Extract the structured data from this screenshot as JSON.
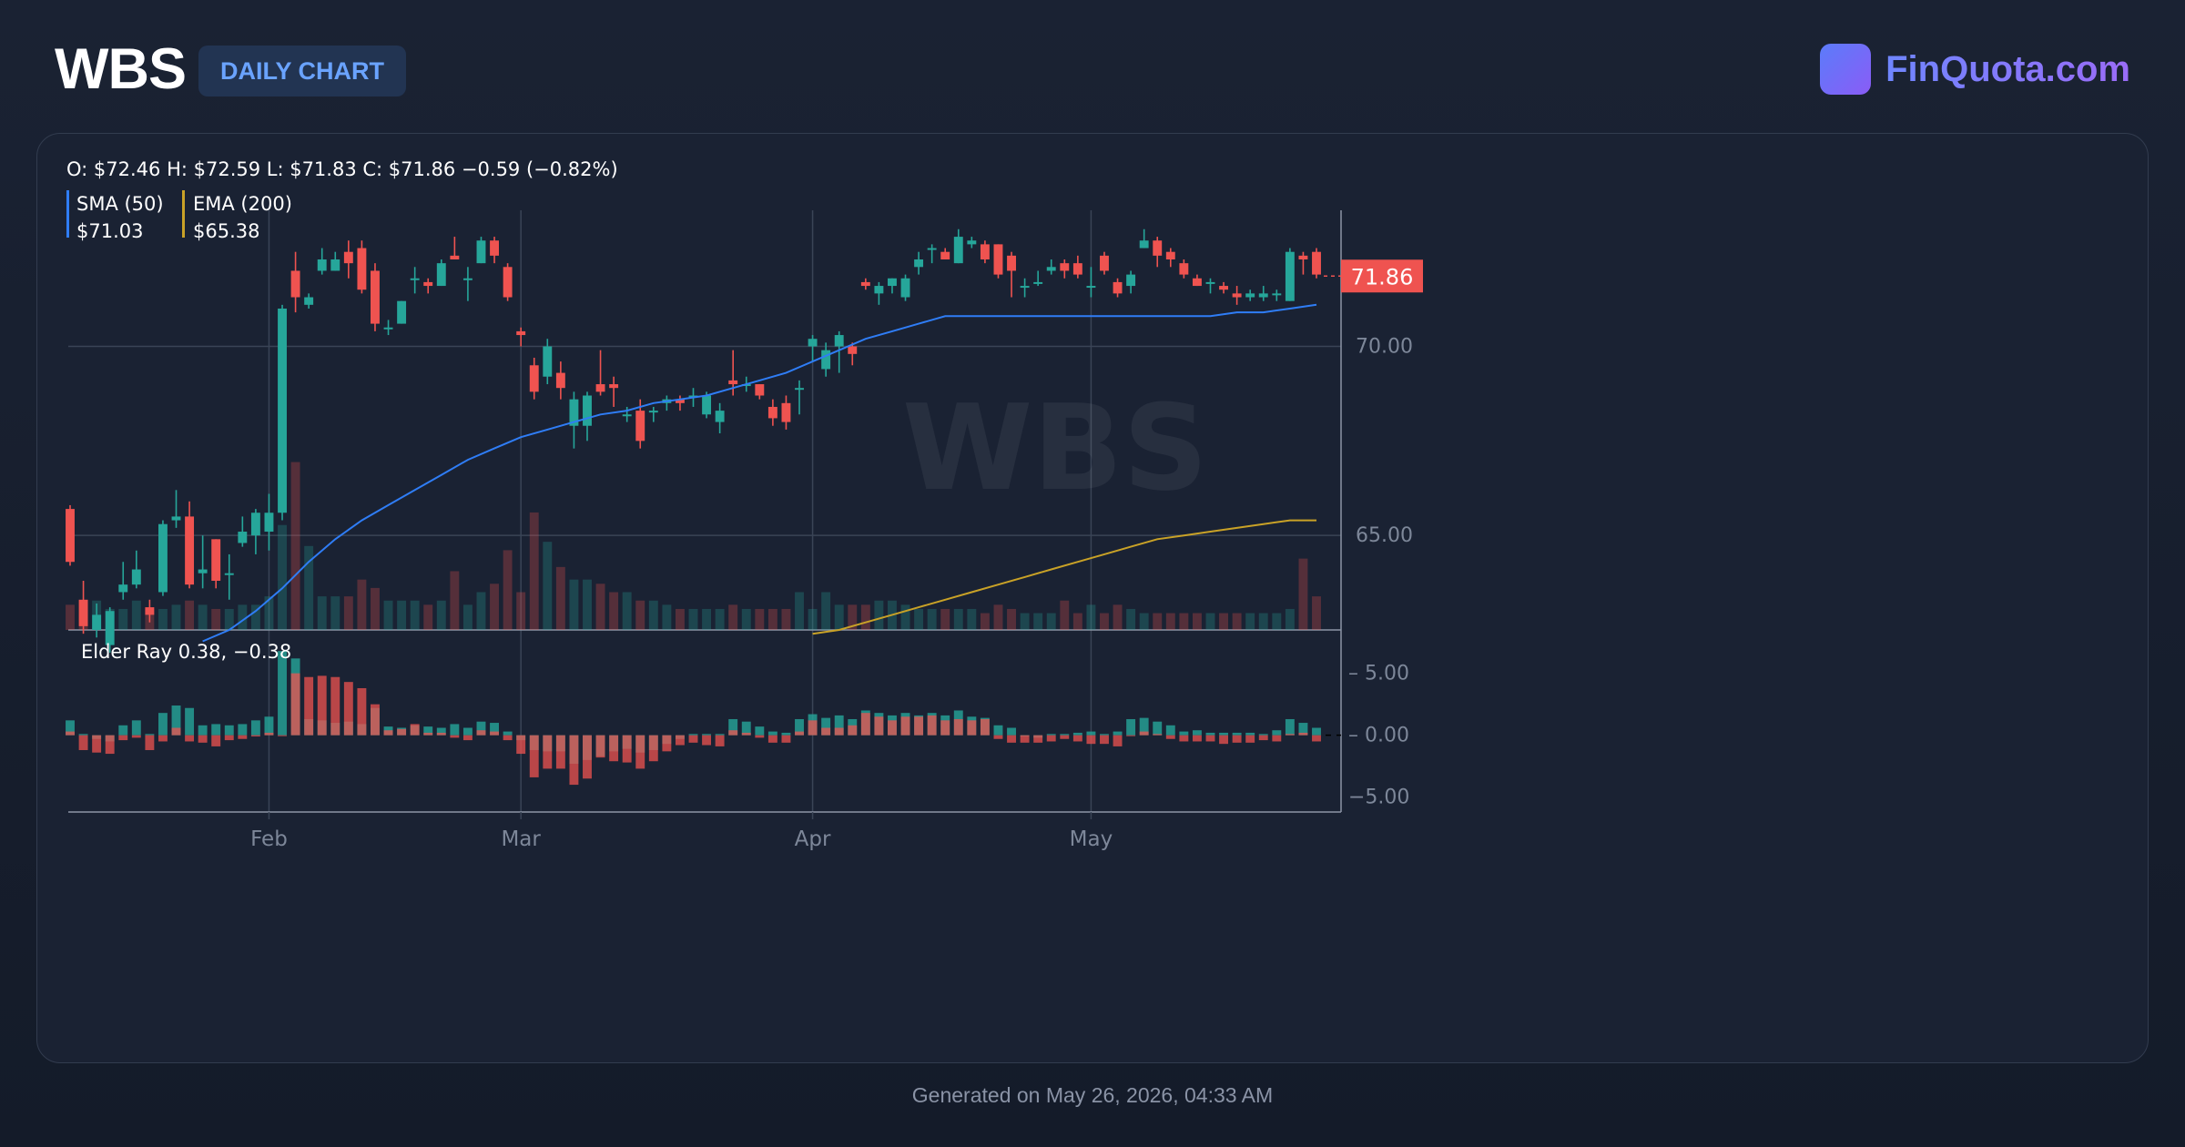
{
  "header": {
    "ticker": "WBS",
    "badge": "DAILY CHART",
    "brand": "FinQuota.com"
  },
  "footer": {
    "generated": "Generated on May 26, 2026, 04:33 AM"
  },
  "legend": {
    "ohlc": "O: $72.46 H: $72.59 L: $71.83 C: $71.86 −0.59 (−0.82%)",
    "sma_label": "SMA (50)",
    "sma_value": "$71.03",
    "ema_label": "EMA (200)",
    "ema_value": "$65.38",
    "elder_label": "Elder Ray 0.38, −0.38"
  },
  "watermark": "WBS",
  "colors": {
    "up": "#26a69a",
    "down": "#ef5350",
    "sma": "#2f7df6",
    "ema": "#c9a227",
    "grid": "#3a4456",
    "axis_text": "#7d8799"
  },
  "chart_data": {
    "type": "candlestick",
    "title": "WBS",
    "x_ticks": [
      {
        "label": "Feb",
        "index": 15
      },
      {
        "label": "Mar",
        "index": 34
      },
      {
        "label": "Apr",
        "index": 56
      },
      {
        "label": "May",
        "index": 77
      }
    ],
    "price_axis": {
      "ylim": [
        62.5,
        73.6
      ],
      "ticks": [
        "70.00",
        "65.00"
      ],
      "last_price": "71.86",
      "last_value": 71.86
    },
    "elder_axis": {
      "ylim": [
        -6.2,
        7.4
      ],
      "ticks": [
        "5.00",
        "0.00",
        "−5.00"
      ]
    },
    "candles": [
      [
        65.7,
        64.3,
        65.8,
        64.2
      ],
      [
        63.3,
        62.6,
        63.8,
        62.4
      ],
      [
        62.5,
        62.9,
        63.2,
        62.3
      ],
      [
        62.1,
        63.0,
        63.1,
        61.9
      ],
      [
        63.5,
        63.7,
        64.3,
        63.3
      ],
      [
        63.7,
        64.1,
        64.6,
        63.6
      ],
      [
        63.1,
        62.9,
        63.3,
        62.7
      ],
      [
        63.5,
        65.3,
        65.4,
        63.4
      ],
      [
        65.4,
        65.5,
        66.2,
        65.2
      ],
      [
        65.5,
        63.7,
        65.9,
        63.6
      ],
      [
        64.0,
        64.1,
        65.0,
        63.6
      ],
      [
        64.9,
        63.8,
        64.9,
        63.6
      ],
      [
        64.0,
        64.0,
        64.5,
        63.3
      ],
      [
        64.8,
        65.1,
        65.5,
        64.7
      ],
      [
        65.0,
        65.6,
        65.7,
        64.5
      ],
      [
        65.1,
        65.6,
        66.1,
        64.6
      ],
      [
        65.6,
        71.0,
        71.1,
        65.4
      ],
      [
        72.0,
        71.3,
        72.5,
        70.9
      ],
      [
        71.1,
        71.3,
        71.4,
        71.0
      ],
      [
        72.0,
        72.3,
        72.6,
        71.9
      ],
      [
        72.0,
        72.3,
        72.5,
        72.0
      ],
      [
        72.5,
        72.2,
        72.8,
        71.8
      ],
      [
        72.6,
        71.5,
        72.8,
        71.4
      ],
      [
        72.0,
        70.6,
        72.2,
        70.4
      ],
      [
        70.5,
        70.5,
        70.7,
        70.3
      ],
      [
        70.6,
        71.2,
        71.2,
        70.6
      ],
      [
        71.8,
        71.8,
        72.1,
        71.4
      ],
      [
        71.7,
        71.6,
        71.8,
        71.4
      ],
      [
        71.6,
        72.2,
        72.3,
        71.6
      ],
      [
        72.4,
        72.3,
        72.9,
        72.3
      ],
      [
        71.8,
        71.8,
        72.1,
        71.2
      ],
      [
        72.2,
        72.8,
        72.9,
        72.2
      ],
      [
        72.8,
        72.4,
        72.9,
        72.2
      ],
      [
        72.1,
        71.3,
        72.2,
        71.2
      ],
      [
        70.4,
        70.3,
        70.5,
        70.0
      ],
      [
        69.5,
        68.8,
        69.7,
        68.6
      ],
      [
        69.2,
        70.0,
        70.2,
        69.0
      ],
      [
        69.3,
        68.9,
        69.6,
        68.6
      ],
      [
        67.9,
        68.6,
        68.8,
        67.3
      ],
      [
        67.9,
        68.7,
        68.8,
        67.5
      ],
      [
        69.0,
        68.8,
        69.9,
        68.7
      ],
      [
        69.0,
        68.9,
        69.2,
        68.4
      ],
      [
        68.2,
        68.2,
        68.4,
        68.0
      ],
      [
        68.3,
        67.5,
        68.6,
        67.3
      ],
      [
        68.3,
        68.3,
        68.4,
        68.0
      ],
      [
        68.5,
        68.6,
        68.7,
        68.3
      ],
      [
        68.6,
        68.5,
        68.7,
        68.3
      ],
      [
        68.7,
        68.7,
        68.9,
        68.4
      ],
      [
        68.2,
        68.7,
        68.8,
        68.1
      ],
      [
        68.0,
        68.3,
        68.5,
        67.7
      ],
      [
        69.1,
        69.0,
        69.9,
        68.7
      ],
      [
        69.0,
        69.0,
        69.2,
        68.8
      ],
      [
        69.0,
        68.7,
        69.0,
        68.6
      ],
      [
        68.4,
        68.1,
        68.6,
        67.9
      ],
      [
        68.5,
        68.0,
        68.7,
        67.8
      ],
      [
        68.9,
        68.9,
        69.1,
        68.2
      ],
      [
        70.0,
        70.2,
        70.3,
        69.6
      ],
      [
        69.4,
        69.9,
        70.1,
        69.2
      ],
      [
        70.0,
        70.3,
        70.4,
        69.3
      ],
      [
        70.0,
        69.8,
        70.1,
        69.5
      ],
      [
        71.7,
        71.6,
        71.8,
        71.5
      ],
      [
        71.4,
        71.6,
        71.7,
        71.1
      ],
      [
        71.6,
        71.8,
        71.8,
        71.4
      ],
      [
        71.3,
        71.8,
        71.9,
        71.2
      ],
      [
        72.1,
        72.3,
        72.5,
        71.9
      ],
      [
        72.6,
        72.6,
        72.7,
        72.2
      ],
      [
        72.5,
        72.3,
        72.6,
        72.3
      ],
      [
        72.2,
        72.9,
        73.1,
        72.2
      ],
      [
        72.7,
        72.8,
        72.9,
        72.6
      ],
      [
        72.7,
        72.3,
        72.8,
        72.2
      ],
      [
        72.7,
        71.9,
        72.7,
        71.8
      ],
      [
        72.4,
        72.0,
        72.5,
        71.3
      ],
      [
        71.6,
        71.6,
        71.8,
        71.3
      ],
      [
        71.7,
        71.7,
        72.0,
        71.6
      ],
      [
        72.0,
        72.1,
        72.3,
        71.9
      ],
      [
        72.2,
        72.0,
        72.3,
        71.8
      ],
      [
        72.2,
        71.9,
        72.4,
        71.8
      ],
      [
        71.6,
        71.6,
        72.1,
        71.3
      ],
      [
        72.4,
        72.0,
        72.5,
        71.9
      ],
      [
        71.7,
        71.4,
        71.8,
        71.3
      ],
      [
        71.6,
        71.9,
        72.0,
        71.4
      ],
      [
        72.6,
        72.8,
        73.1,
        72.6
      ],
      [
        72.8,
        72.4,
        72.9,
        72.1
      ],
      [
        72.5,
        72.3,
        72.6,
        72.1
      ],
      [
        72.2,
        71.9,
        72.3,
        71.8
      ],
      [
        71.8,
        71.6,
        71.9,
        71.6
      ],
      [
        71.7,
        71.7,
        71.8,
        71.4
      ],
      [
        71.6,
        71.5,
        71.7,
        71.4
      ],
      [
        71.4,
        71.3,
        71.6,
        71.1
      ],
      [
        71.3,
        71.4,
        71.5,
        71.2
      ],
      [
        71.3,
        71.4,
        71.6,
        71.2
      ],
      [
        71.4,
        71.4,
        71.5,
        71.2
      ],
      [
        71.2,
        72.5,
        72.6,
        71.2
      ],
      [
        72.4,
        72.3,
        72.5,
        71.9
      ],
      [
        72.5,
        71.9,
        72.6,
        71.8
      ]
    ],
    "volume": [
      0.06,
      0.07,
      0.07,
      0.05,
      0.05,
      0.07,
      0.05,
      0.05,
      0.06,
      0.07,
      0.06,
      0.05,
      0.05,
      0.06,
      0.06,
      0.08,
      0.25,
      0.4,
      0.2,
      0.08,
      0.08,
      0.08,
      0.12,
      0.1,
      0.07,
      0.07,
      0.07,
      0.06,
      0.07,
      0.14,
      0.06,
      0.09,
      0.11,
      0.19,
      0.09,
      0.28,
      0.21,
      0.15,
      0.12,
      0.12,
      0.11,
      0.09,
      0.09,
      0.07,
      0.07,
      0.06,
      0.05,
      0.05,
      0.05,
      0.05,
      0.06,
      0.05,
      0.05,
      0.05,
      0.05,
      0.09,
      0.05,
      0.09,
      0.06,
      0.06,
      0.06,
      0.07,
      0.07,
      0.06,
      0.05,
      0.05,
      0.05,
      0.05,
      0.05,
      0.04,
      0.06,
      0.05,
      0.04,
      0.04,
      0.04,
      0.07,
      0.04,
      0.06,
      0.04,
      0.06,
      0.05,
      0.04,
      0.04,
      0.04,
      0.04,
      0.04,
      0.04,
      0.04,
      0.04,
      0.04,
      0.04,
      0.04,
      0.05,
      0.17,
      0.08
    ],
    "sma50": [
      [
        10,
        62.2
      ],
      [
        12,
        62.5
      ],
      [
        14,
        63.0
      ],
      [
        16,
        63.6
      ],
      [
        18,
        64.3
      ],
      [
        20,
        64.9
      ],
      [
        22,
        65.4
      ],
      [
        24,
        65.8
      ],
      [
        26,
        66.2
      ],
      [
        28,
        66.6
      ],
      [
        30,
        67.0
      ],
      [
        32,
        67.3
      ],
      [
        34,
        67.6
      ],
      [
        36,
        67.8
      ],
      [
        38,
        68.0
      ],
      [
        40,
        68.2
      ],
      [
        42,
        68.3
      ],
      [
        44,
        68.5
      ],
      [
        46,
        68.6
      ],
      [
        48,
        68.7
      ],
      [
        50,
        68.9
      ],
      [
        52,
        69.1
      ],
      [
        54,
        69.3
      ],
      [
        56,
        69.6
      ],
      [
        58,
        69.9
      ],
      [
        60,
        70.2
      ],
      [
        62,
        70.4
      ],
      [
        64,
        70.6
      ],
      [
        66,
        70.8
      ],
      [
        68,
        70.8
      ],
      [
        70,
        70.8
      ],
      [
        72,
        70.8
      ],
      [
        74,
        70.8
      ],
      [
        76,
        70.8
      ],
      [
        78,
        70.8
      ],
      [
        80,
        70.8
      ],
      [
        82,
        70.8
      ],
      [
        84,
        70.8
      ],
      [
        86,
        70.8
      ],
      [
        88,
        70.9
      ],
      [
        90,
        70.9
      ],
      [
        92,
        71.0
      ],
      [
        94,
        71.1
      ]
    ],
    "ema200": [
      [
        56,
        62.4
      ],
      [
        58,
        62.5
      ],
      [
        60,
        62.7
      ],
      [
        62,
        62.9
      ],
      [
        64,
        63.1
      ],
      [
        66,
        63.3
      ],
      [
        68,
        63.5
      ],
      [
        70,
        63.7
      ],
      [
        72,
        63.9
      ],
      [
        74,
        64.1
      ],
      [
        76,
        64.3
      ],
      [
        78,
        64.5
      ],
      [
        80,
        64.7
      ],
      [
        82,
        64.9
      ],
      [
        84,
        65.0
      ],
      [
        86,
        65.1
      ],
      [
        88,
        65.2
      ],
      [
        90,
        65.3
      ],
      [
        92,
        65.4
      ],
      [
        94,
        65.4
      ]
    ],
    "bull_power": [
      1.2,
      0.1,
      -0.3,
      -0.5,
      0.8,
      1.2,
      0.1,
      1.8,
      2.4,
      2.2,
      0.8,
      0.9,
      0.8,
      0.9,
      1.2,
      1.5,
      6.8,
      6.2,
      1.3,
      1.2,
      1.0,
      1.1,
      0.9,
      2.2,
      0.7,
      0.6,
      0.8,
      0.7,
      0.6,
      0.9,
      0.6,
      1.1,
      1.0,
      0.3,
      -0.4,
      -1.2,
      -1.3,
      -1.3,
      -2.3,
      -2.0,
      -1.7,
      -1.3,
      -1.1,
      -1.4,
      -1.2,
      -0.7,
      -0.3,
      0.1,
      0.1,
      0.1,
      1.3,
      1.1,
      0.7,
      0.3,
      0.2,
      1.3,
      1.7,
      1.4,
      1.6,
      1.3,
      2.0,
      1.8,
      1.6,
      1.8,
      1.6,
      1.8,
      1.6,
      2.0,
      1.5,
      1.4,
      0.8,
      0.6,
      -0.1,
      -0.2,
      0.1,
      0.1,
      0.2,
      0.3,
      0.1,
      0.3,
      1.3,
      1.4,
      1.1,
      0.8,
      0.3,
      0.4,
      0.2,
      0.2,
      0.2,
      0.2,
      0.1,
      0.4,
      1.3,
      1.0,
      0.6
    ],
    "bear_power": [
      0.3,
      -1.2,
      -1.4,
      -1.5,
      -0.4,
      -0.2,
      -1.2,
      -0.5,
      0.6,
      -0.5,
      -0.6,
      -0.9,
      -0.4,
      -0.3,
      -0.1,
      0.2,
      0.0,
      5.0,
      4.7,
      4.8,
      4.7,
      4.3,
      3.8,
      2.5,
      0.4,
      0.5,
      0.9,
      0.2,
      0.2,
      -0.2,
      -0.4,
      0.4,
      0.3,
      -0.4,
      -1.5,
      -3.4,
      -2.7,
      -2.7,
      -4.0,
      -3.5,
      -1.8,
      -2.1,
      -2.2,
      -2.7,
      -2.1,
      -1.3,
      -0.8,
      -0.6,
      -0.8,
      -0.9,
      0.4,
      0.2,
      -0.2,
      -0.6,
      -0.6,
      0.3,
      1.2,
      0.6,
      0.6,
      0.8,
      1.8,
      1.5,
      1.2,
      1.5,
      1.5,
      1.6,
      1.2,
      1.3,
      1.2,
      1.3,
      -0.3,
      -0.6,
      -0.6,
      -0.6,
      -0.5,
      -0.3,
      -0.5,
      -0.7,
      -0.7,
      -0.9,
      0.0,
      0.3,
      0.1,
      -0.3,
      -0.5,
      -0.5,
      -0.5,
      -0.7,
      -0.6,
      -0.6,
      -0.4,
      -0.5,
      0.1,
      0.2,
      -0.5
    ]
  }
}
